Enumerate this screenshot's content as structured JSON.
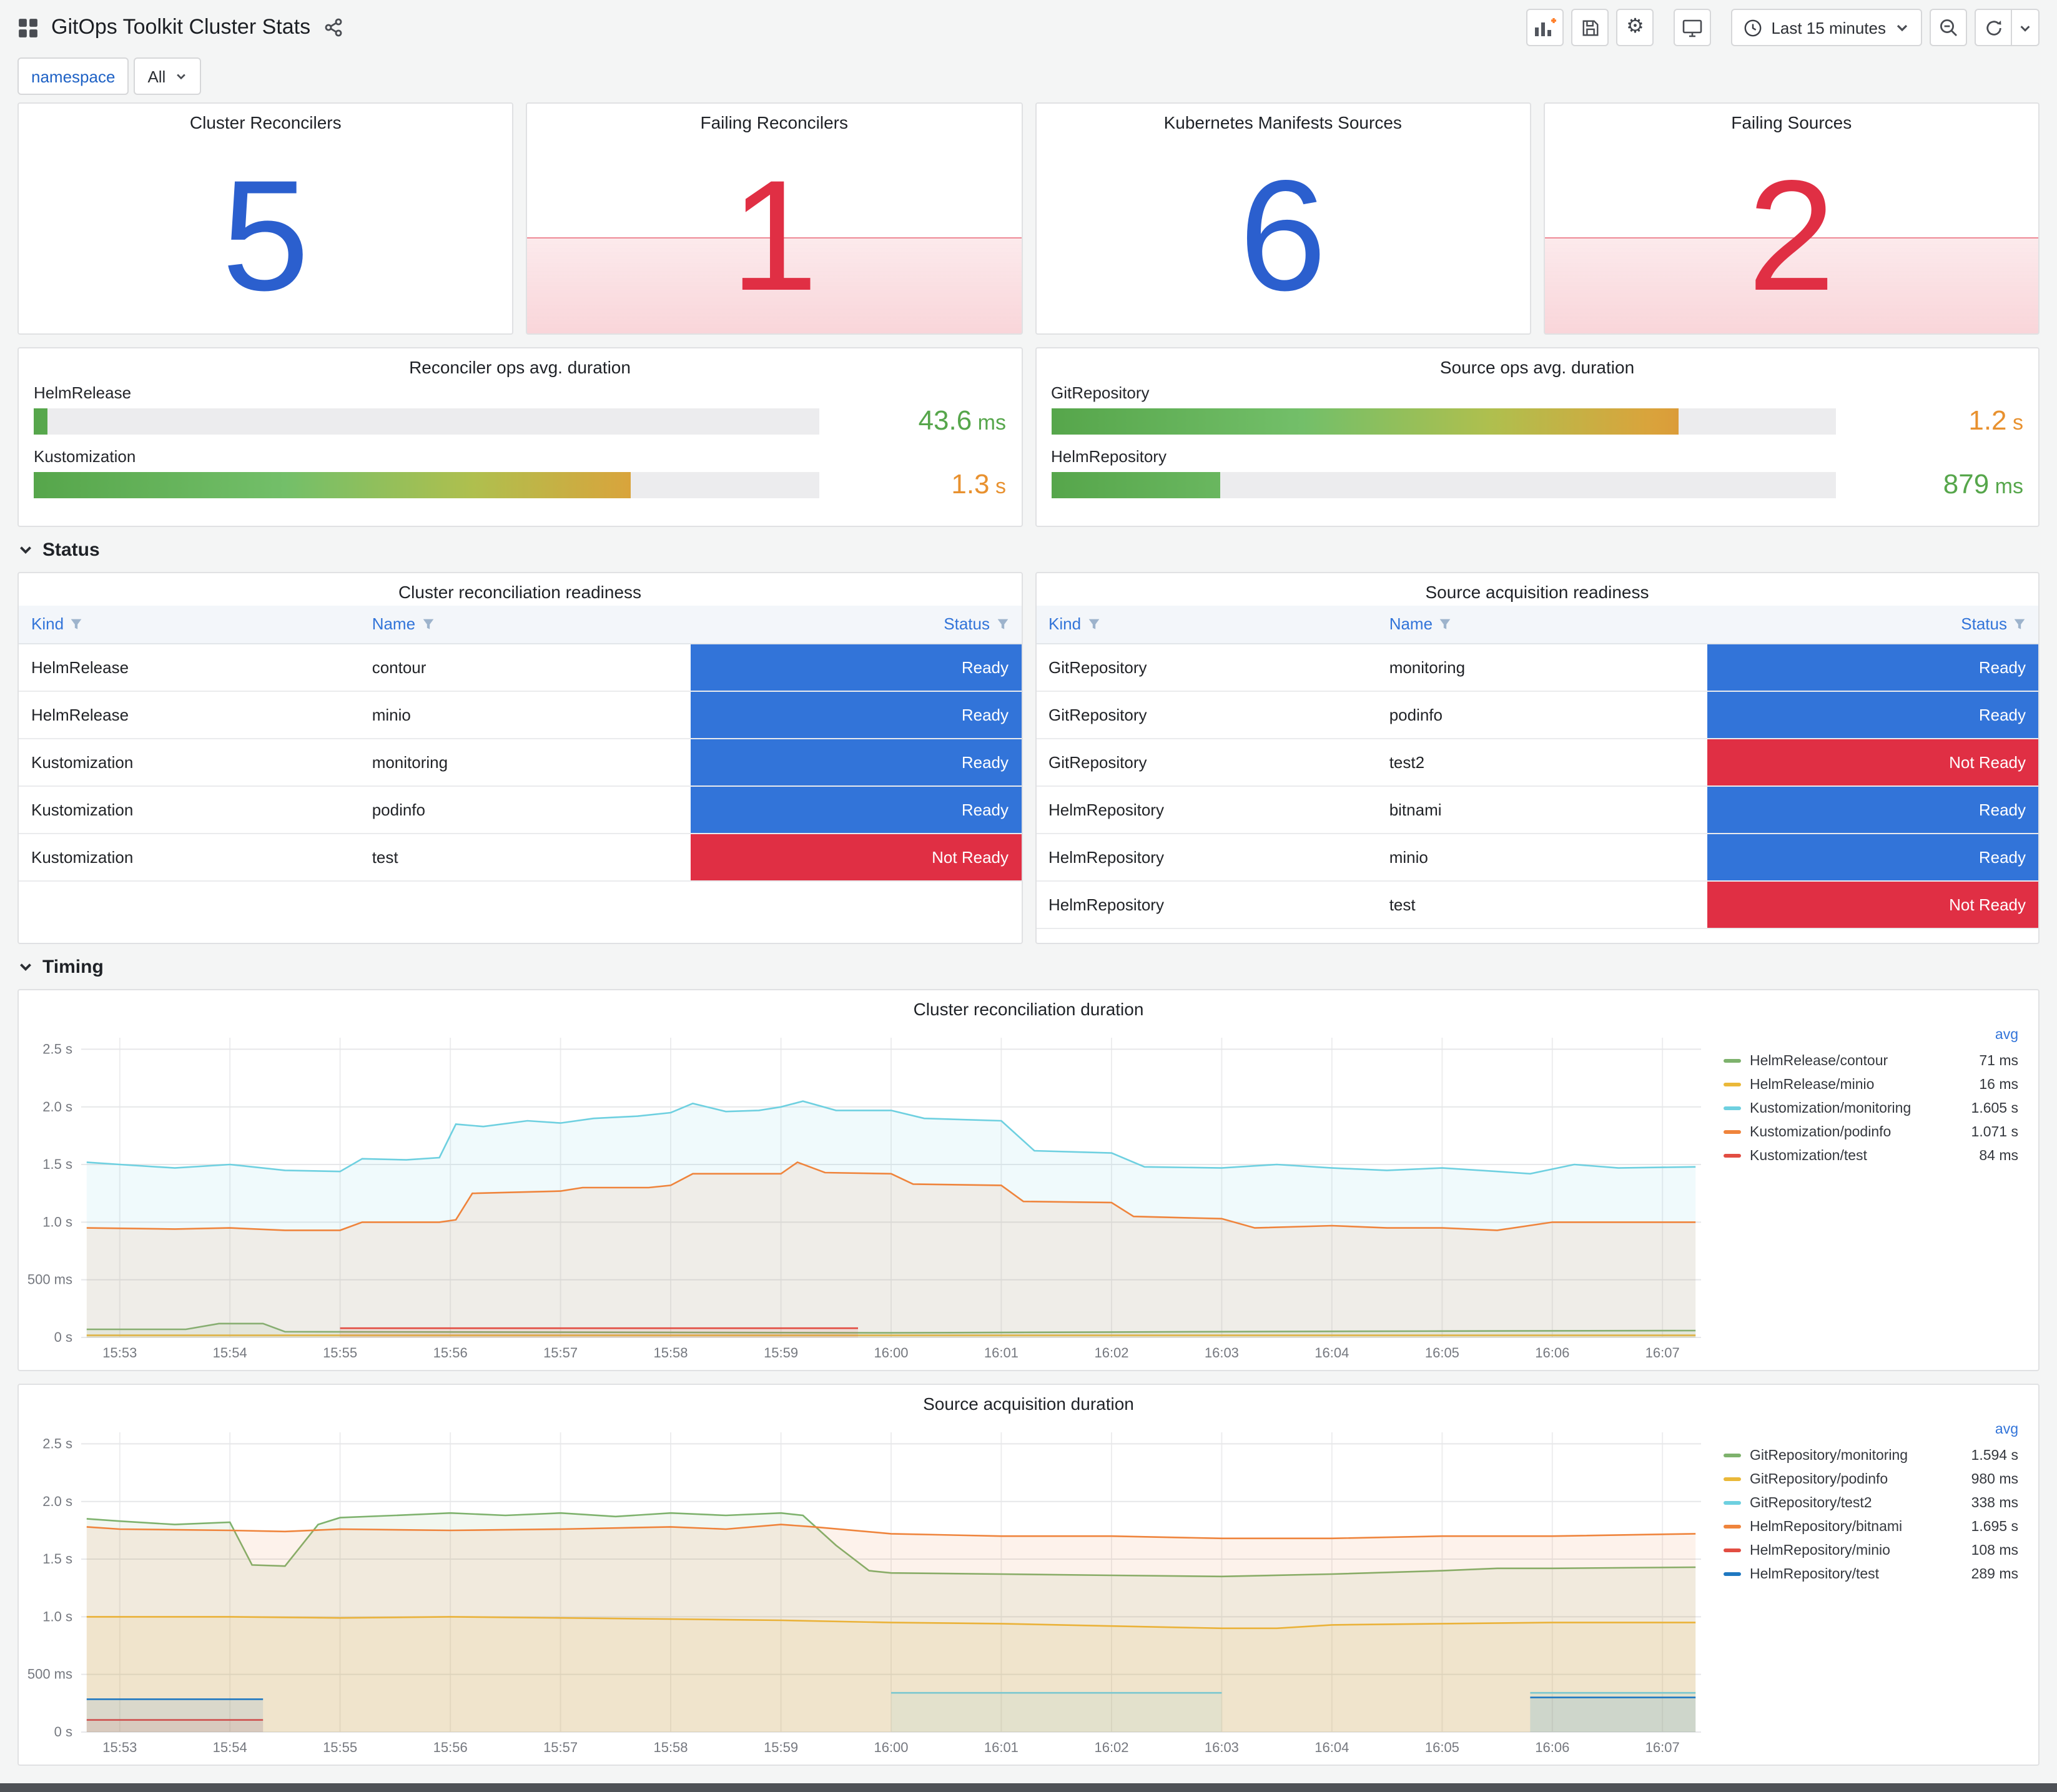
{
  "header": {
    "title": "GitOps Toolkit Cluster Stats",
    "time_range_label": "Last 15 minutes"
  },
  "variables": {
    "label": "namespace",
    "value": "All"
  },
  "colors": {
    "stat_ok": "#2B5FCE",
    "stat_alert": "#E02F44",
    "status": {
      "Ready": "#3274D9",
      "Not Ready": "#E02F44"
    }
  },
  "stats": [
    {
      "title": "Cluster Reconcilers",
      "value": "5",
      "alert": false,
      "color": "#2B5FCE"
    },
    {
      "title": "Failing Reconcilers",
      "value": "1",
      "alert": true,
      "color": "#E02F44"
    },
    {
      "title": "Kubernetes Manifests Sources",
      "value": "6",
      "alert": false,
      "color": "#2B5FCE"
    },
    {
      "title": "Failing Sources",
      "value": "2",
      "alert": true,
      "color": "#E02F44"
    }
  ],
  "gauges": [
    {
      "title": "Reconciler ops avg. duration",
      "rows": [
        {
          "label": "HelmRelease",
          "value": "43.6",
          "unit": "ms",
          "percent": 1.8,
          "value_color": "#56A64B"
        },
        {
          "label": "Kustomization",
          "value": "1.3",
          "unit": "s",
          "percent": 76,
          "value_color": "#E8912F"
        }
      ]
    },
    {
      "title": "Source ops avg. duration",
      "rows": [
        {
          "label": "GitRepository",
          "value": "1.2",
          "unit": "s",
          "percent": 80,
          "value_color": "#E8912F"
        },
        {
          "label": "HelmRepository",
          "value": "879",
          "unit": "ms",
          "percent": 21.5,
          "value_color": "#56A64B"
        }
      ]
    }
  ],
  "sections": {
    "status": "Status",
    "timing": "Timing"
  },
  "tables": [
    {
      "title": "Cluster reconciliation readiness",
      "columns": [
        "Kind",
        "Name",
        "Status"
      ],
      "rows": [
        {
          "kind": "HelmRelease",
          "name": "contour",
          "status": "Ready"
        },
        {
          "kind": "HelmRelease",
          "name": "minio",
          "status": "Ready"
        },
        {
          "kind": "Kustomization",
          "name": "monitoring",
          "status": "Ready"
        },
        {
          "kind": "Kustomization",
          "name": "podinfo",
          "status": "Ready"
        },
        {
          "kind": "Kustomization",
          "name": "test",
          "status": "Not Ready"
        }
      ]
    },
    {
      "title": "Source acquisition readiness",
      "columns": [
        "Kind",
        "Name",
        "Status"
      ],
      "rows": [
        {
          "kind": "GitRepository",
          "name": "monitoring",
          "status": "Ready"
        },
        {
          "kind": "GitRepository",
          "name": "podinfo",
          "status": "Ready"
        },
        {
          "kind": "GitRepository",
          "name": "test2",
          "status": "Not Ready"
        },
        {
          "kind": "HelmRepository",
          "name": "bitnami",
          "status": "Ready"
        },
        {
          "kind": "HelmRepository",
          "name": "minio",
          "status": "Ready"
        },
        {
          "kind": "HelmRepository",
          "name": "test",
          "status": "Not Ready"
        }
      ]
    }
  ],
  "chart_data": [
    {
      "type": "line",
      "title": "Cluster reconciliation duration",
      "xlabel": "",
      "ylabel": "",
      "x_domain": [
        0.65,
        15.35
      ],
      "y_max": 2.6,
      "grid": true,
      "legend_position": "right",
      "legend_value_header": "avg",
      "x_ticks": [
        "15:53",
        "15:54",
        "15:55",
        "15:56",
        "15:57",
        "15:58",
        "15:59",
        "16:00",
        "16:01",
        "16:02",
        "16:03",
        "16:04",
        "16:05",
        "16:06",
        "16:07"
      ],
      "y_ticks": [
        {
          "label": "0 s",
          "v": 0
        },
        {
          "label": "500 ms",
          "v": 0.5
        },
        {
          "label": "1.0 s",
          "v": 1
        },
        {
          "label": "1.5 s",
          "v": 1.5
        },
        {
          "label": "2.0 s",
          "v": 2
        },
        {
          "label": "2.5 s",
          "v": 2.5
        }
      ],
      "series": [
        {
          "name": "HelmRelease/contour",
          "color": "#7EB26D",
          "avg": "71 ms",
          "segments": [
            [
              [
                0.7,
                0.07
              ],
              [
                1.6,
                0.07
              ],
              [
                1.9,
                0.12
              ],
              [
                2.3,
                0.12
              ],
              [
                2.5,
                0.05
              ],
              [
                5,
                0.045
              ],
              [
                8,
                0.04
              ],
              [
                11,
                0.05
              ],
              [
                13,
                0.055
              ],
              [
                15.3,
                0.06
              ]
            ]
          ]
        },
        {
          "name": "HelmRelease/minio",
          "color": "#EAB839",
          "avg": "16 ms",
          "segments": [
            [
              [
                0.7,
                0.018
              ],
              [
                15.3,
                0.018
              ]
            ]
          ]
        },
        {
          "name": "Kustomization/monitoring",
          "color": "#6ED0E0",
          "avg": "1.605 s",
          "segments": [
            [
              [
                0.7,
                1.52
              ],
              [
                1,
                1.5
              ],
              [
                1.5,
                1.47
              ],
              [
                2,
                1.5
              ],
              [
                2.5,
                1.45
              ],
              [
                3,
                1.44
              ],
              [
                3.2,
                1.55
              ],
              [
                3.6,
                1.54
              ],
              [
                3.9,
                1.56
              ],
              [
                4.05,
                1.85
              ],
              [
                4.3,
                1.83
              ],
              [
                4.7,
                1.88
              ],
              [
                5,
                1.86
              ],
              [
                5.3,
                1.9
              ],
              [
                5.7,
                1.92
              ],
              [
                6,
                1.95
              ],
              [
                6.2,
                2.03
              ],
              [
                6.5,
                1.96
              ],
              [
                6.8,
                1.97
              ],
              [
                7,
                2.0
              ],
              [
                7.2,
                2.05
              ],
              [
                7.5,
                1.97
              ],
              [
                8,
                1.97
              ],
              [
                8.3,
                1.9
              ],
              [
                9,
                1.88
              ],
              [
                9.3,
                1.62
              ],
              [
                10,
                1.6
              ],
              [
                10.3,
                1.48
              ],
              [
                11,
                1.47
              ],
              [
                11.5,
                1.5
              ],
              [
                12,
                1.47
              ],
              [
                12.5,
                1.45
              ],
              [
                13,
                1.47
              ],
              [
                13.5,
                1.44
              ],
              [
                13.8,
                1.42
              ],
              [
                14.2,
                1.5
              ],
              [
                14.6,
                1.47
              ],
              [
                15.3,
                1.48
              ]
            ]
          ]
        },
        {
          "name": "Kustomization/podinfo",
          "color": "#EF843C",
          "avg": "1.071 s",
          "segments": [
            [
              [
                0.7,
                0.95
              ],
              [
                1.5,
                0.94
              ],
              [
                2,
                0.95
              ],
              [
                2.5,
                0.93
              ],
              [
                3,
                0.93
              ],
              [
                3.2,
                1.0
              ],
              [
                3.9,
                1.0
              ],
              [
                4.05,
                1.02
              ],
              [
                4.2,
                1.25
              ],
              [
                5,
                1.27
              ],
              [
                5.2,
                1.3
              ],
              [
                5.8,
                1.3
              ],
              [
                6,
                1.32
              ],
              [
                6.2,
                1.42
              ],
              [
                7,
                1.42
              ],
              [
                7.15,
                1.52
              ],
              [
                7.4,
                1.43
              ],
              [
                8,
                1.42
              ],
              [
                8.2,
                1.33
              ],
              [
                9,
                1.32
              ],
              [
                9.2,
                1.18
              ],
              [
                10,
                1.17
              ],
              [
                10.2,
                1.05
              ],
              [
                11,
                1.03
              ],
              [
                11.3,
                0.95
              ],
              [
                12,
                0.97
              ],
              [
                12.5,
                0.95
              ],
              [
                13,
                0.95
              ],
              [
                13.5,
                0.93
              ],
              [
                14,
                1.0
              ],
              [
                14.5,
                1.0
              ],
              [
                15.3,
                1.0
              ]
            ]
          ]
        },
        {
          "name": "Kustomization/test",
          "color": "#E24D42",
          "avg": "84 ms",
          "segments": [
            [
              [
                3,
                0.08
              ],
              [
                7.7,
                0.08
              ]
            ]
          ]
        }
      ]
    },
    {
      "type": "line",
      "title": "Source acquisition duration",
      "xlabel": "",
      "ylabel": "",
      "x_domain": [
        0.65,
        15.35
      ],
      "y_max": 2.6,
      "grid": true,
      "legend_position": "right",
      "legend_value_header": "avg",
      "x_ticks": [
        "15:53",
        "15:54",
        "15:55",
        "15:56",
        "15:57",
        "15:58",
        "15:59",
        "16:00",
        "16:01",
        "16:02",
        "16:03",
        "16:04",
        "16:05",
        "16:06",
        "16:07"
      ],
      "y_ticks": [
        {
          "label": "0 s",
          "v": 0
        },
        {
          "label": "500 ms",
          "v": 0.5
        },
        {
          "label": "1.0 s",
          "v": 1
        },
        {
          "label": "1.5 s",
          "v": 1.5
        },
        {
          "label": "2.0 s",
          "v": 2
        },
        {
          "label": "2.5 s",
          "v": 2.5
        }
      ],
      "series": [
        {
          "name": "GitRepository/monitoring",
          "color": "#7EB26D",
          "avg": "1.594 s",
          "segments": [
            [
              [
                0.7,
                1.85
              ],
              [
                1,
                1.83
              ],
              [
                1.5,
                1.8
              ],
              [
                2,
                1.82
              ],
              [
                2.2,
                1.45
              ],
              [
                2.5,
                1.44
              ],
              [
                2.8,
                1.8
              ],
              [
                3,
                1.86
              ],
              [
                3.5,
                1.88
              ],
              [
                4,
                1.9
              ],
              [
                4.5,
                1.88
              ],
              [
                5,
                1.9
              ],
              [
                5.5,
                1.87
              ],
              [
                6,
                1.9
              ],
              [
                6.5,
                1.88
              ],
              [
                7,
                1.9
              ],
              [
                7.2,
                1.88
              ],
              [
                7.5,
                1.62
              ],
              [
                7.8,
                1.4
              ],
              [
                8,
                1.38
              ],
              [
                9,
                1.37
              ],
              [
                10,
                1.36
              ],
              [
                11,
                1.35
              ],
              [
                12,
                1.37
              ],
              [
                13,
                1.4
              ],
              [
                13.5,
                1.42
              ],
              [
                14,
                1.42
              ],
              [
                15.3,
                1.43
              ]
            ]
          ]
        },
        {
          "name": "GitRepository/podinfo",
          "color": "#EAB839",
          "avg": "980 ms",
          "segments": [
            [
              [
                0.7,
                1.0
              ],
              [
                2,
                1.0
              ],
              [
                3,
                0.99
              ],
              [
                4,
                1.0
              ],
              [
                5,
                0.99
              ],
              [
                6,
                0.98
              ],
              [
                7,
                0.97
              ],
              [
                8,
                0.95
              ],
              [
                9,
                0.94
              ],
              [
                10,
                0.92
              ],
              [
                11,
                0.9
              ],
              [
                11.5,
                0.9
              ],
              [
                12,
                0.93
              ],
              [
                13,
                0.94
              ],
              [
                14,
                0.95
              ],
              [
                15.3,
                0.95
              ]
            ]
          ]
        },
        {
          "name": "GitRepository/test2",
          "color": "#6ED0E0",
          "avg": "338 ms",
          "segments": [
            [
              [
                8,
                0.34
              ],
              [
                11,
                0.34
              ]
            ],
            [
              [
                13.8,
                0.34
              ],
              [
                15.3,
                0.34
              ]
            ]
          ]
        },
        {
          "name": "HelmRepository/bitnami",
          "color": "#EF843C",
          "avg": "1.695 s",
          "segments": [
            [
              [
                0.7,
                1.78
              ],
              [
                1,
                1.76
              ],
              [
                2,
                1.75
              ],
              [
                2.5,
                1.74
              ],
              [
                3,
                1.76
              ],
              [
                4,
                1.75
              ],
              [
                5,
                1.76
              ],
              [
                6,
                1.78
              ],
              [
                6.5,
                1.76
              ],
              [
                7,
                1.8
              ],
              [
                7.3,
                1.78
              ],
              [
                8,
                1.72
              ],
              [
                9,
                1.7
              ],
              [
                10,
                1.7
              ],
              [
                11,
                1.68
              ],
              [
                12,
                1.68
              ],
              [
                13,
                1.7
              ],
              [
                14,
                1.7
              ],
              [
                15.3,
                1.72
              ]
            ]
          ]
        },
        {
          "name": "HelmRepository/minio",
          "color": "#E24D42",
          "avg": "108 ms",
          "segments": [
            [
              [
                0.7,
                0.105
              ],
              [
                2.3,
                0.105
              ]
            ]
          ]
        },
        {
          "name": "HelmRepository/test",
          "color": "#1F78C1",
          "avg": "289 ms",
          "segments": [
            [
              [
                0.7,
                0.285
              ],
              [
                2.3,
                0.285
              ]
            ],
            [
              [
                13.8,
                0.3
              ],
              [
                15.3,
                0.3
              ]
            ]
          ]
        }
      ]
    }
  ]
}
